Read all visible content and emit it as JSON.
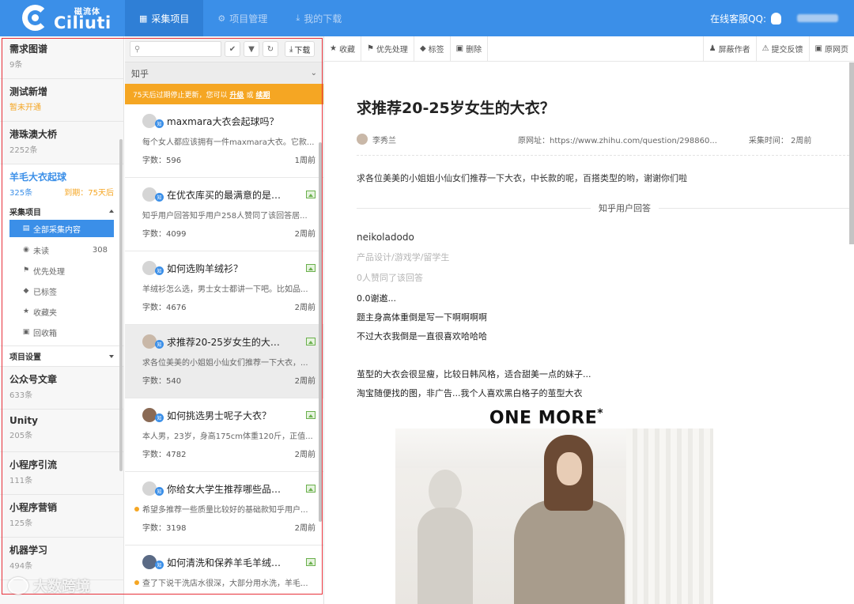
{
  "topbar": {
    "logo_cn": "磁流体",
    "logo_en": "Ciliuti",
    "nav": [
      {
        "label": "采集项目",
        "icon": "save-icon",
        "active": true
      },
      {
        "label": "项目管理",
        "icon": "gear-icon",
        "active": false
      },
      {
        "label": "我的下载",
        "icon": "download-icon",
        "active": false
      }
    ],
    "support_label": "在线客服QQ:"
  },
  "sidebar": {
    "projects_top": [
      {
        "name": "需求图谱",
        "count": "9条"
      },
      {
        "name": "测试新增",
        "count": "暂未开通"
      },
      {
        "name": "港珠澳大桥",
        "count": "2252条"
      }
    ],
    "active_project": {
      "name": "羊毛大衣起球",
      "count": "325条",
      "expiry": "到期：75天后"
    },
    "collect_section": "采集项目",
    "sub_items": [
      {
        "label": "全部采集内容",
        "icon": "list-icon",
        "count": ""
      },
      {
        "label": "未读",
        "icon": "eye-icon",
        "count": "308"
      },
      {
        "label": "优先处理",
        "icon": "flag-icon",
        "count": ""
      },
      {
        "label": "已标签",
        "icon": "tag-icon",
        "count": ""
      },
      {
        "label": "收藏夹",
        "icon": "star-icon",
        "count": ""
      },
      {
        "label": "回收箱",
        "icon": "trash-icon",
        "count": ""
      }
    ],
    "settings_section": "项目设置",
    "projects_bottom": [
      {
        "name": "公众号文章",
        "count": "633条"
      },
      {
        "name": "Unity",
        "count": "205条"
      },
      {
        "name": "小程序引流",
        "count": "111条"
      },
      {
        "name": "小程序营销",
        "count": "125条"
      },
      {
        "name": "机器学习",
        "count": "494条"
      }
    ]
  },
  "list": {
    "search_placeholder": "",
    "download_label": "下载",
    "source": "知乎",
    "notice_text": "75天后过期停止更新，您可以",
    "notice_upgrade": "升级",
    "notice_or": "或",
    "notice_renew": "续期",
    "items": [
      {
        "title": "maxmara大衣会起球吗？",
        "desc": "每个女人都应该拥有一件maxmara大衣。它款...",
        "words": "字数：596",
        "time": "1周前",
        "unread": false,
        "has_image": false
      },
      {
        "title": "在优衣库买的最满意的是什...",
        "desc": "知乎用户回答知乎用户258人赞同了该回答居...",
        "words": "字数：4099",
        "time": "2周前",
        "unread": false,
        "has_image": true
      },
      {
        "title": "如何选购羊绒衫？",
        "desc": "羊绒衫怎么选，男士女士都讲一下吧。比如品...",
        "words": "字数：4676",
        "time": "2周前",
        "unread": false,
        "has_image": true
      },
      {
        "title": "求推荐20-25岁女生的大衣？",
        "desc": "求各位美美的小姐姐小仙女们推荐一下大衣，...",
        "words": "字数：540",
        "time": "2周前",
        "unread": false,
        "has_image": true
      },
      {
        "title": "如何挑选男士呢子大衣？",
        "desc": "本人男，23岁，身高175cm体重120斤，正值...",
        "words": "字数：4782",
        "time": "2周前",
        "unread": false,
        "has_image": true
      },
      {
        "title": "你给女大学生推荐哪些品牌...",
        "desc": "希望多推荐一些质量比较好的基础款知乎用户...",
        "words": "字数：3198",
        "time": "2周前",
        "unread": true,
        "has_image": true
      },
      {
        "title": "如何清洗和保养羊毛羊绒衫...",
        "desc": "查了下说干洗店水很深，大部分用水洗，羊毛...",
        "words": "",
        "time": "",
        "unread": true,
        "has_image": true
      }
    ]
  },
  "content": {
    "toolbar_left": [
      {
        "label": "收藏",
        "icon": "star-icon"
      },
      {
        "label": "优先处理",
        "icon": "flag-icon"
      },
      {
        "label": "标签",
        "icon": "tag-icon"
      },
      {
        "label": "删除",
        "icon": "trash-icon"
      }
    ],
    "toolbar_right": [
      {
        "label": "屏蔽作者",
        "icon": "block-user-icon"
      },
      {
        "label": "提交反馈",
        "icon": "warning-icon"
      },
      {
        "label": "原网页",
        "icon": "window-icon"
      }
    ],
    "title": "求推荐20-25岁女生的大衣？",
    "author": "李秀兰",
    "source_url": "原网址：https://www.zhihu.com/question/298860...",
    "collect_time": "采集时间：  2周前",
    "question": "求各位美美的小姐姐小仙女们推荐一下大衣，中长款的呢，百搭类型的哟，谢谢你们啦",
    "answers_divider": "知乎用户回答",
    "answer_author": "neikoladodo",
    "answer_tags": "产品设计/游戏学/留学生",
    "answer_votes": "0人赞同了该回答",
    "answer_lines": [
      "0.0谢邀...",
      "题主身高体重倒是写一下啊啊啊啊",
      "不过大衣我倒是一直很喜欢哈哈哈"
    ],
    "answer_lines2": [
      "茧型的大衣会很显瘦，比较日韩风格，适合甜美一点的妹子...",
      "淘宝随便找的图，非广告...我个人喜欢黑白格子的茧型大衣"
    ],
    "brand_text": "ONE MORE",
    "brand_mark": "*"
  },
  "watermark": "大数跨境"
}
